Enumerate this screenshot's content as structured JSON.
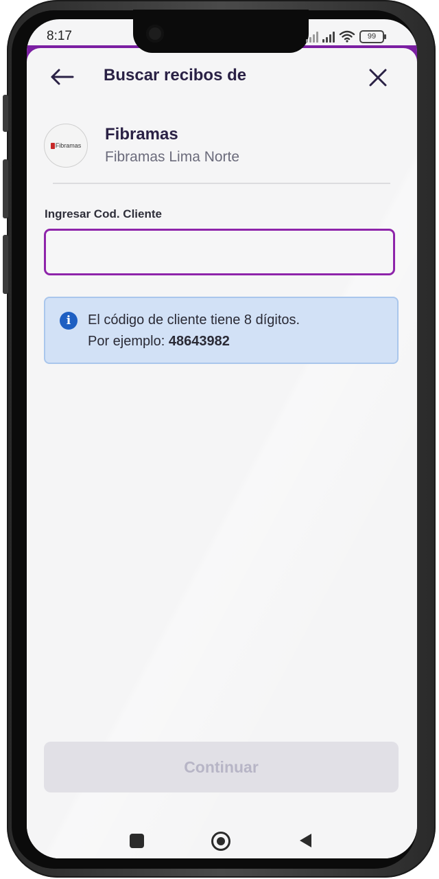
{
  "status_bar": {
    "time": "8:17",
    "battery": "99"
  },
  "header": {
    "title": "Buscar recibos de",
    "back_icon": "arrow-left-icon",
    "close_icon": "close-icon"
  },
  "company": {
    "logo_text": "Fibramas",
    "name": "Fibramas",
    "branch": "Fibramas Lima Norte"
  },
  "form": {
    "label": "Ingresar Cod. Cliente",
    "value": "",
    "accent_color": "#8e24aa"
  },
  "info": {
    "line1": "El código de cliente tiene 8 dígitos.",
    "example_prefix": "Por ejemplo: ",
    "example_code": "48643982"
  },
  "footer": {
    "continue_label": "Continuar",
    "continue_disabled": true
  },
  "colors": {
    "brand_purple": "#7b1fa2",
    "info_bg": "#d2e1f6",
    "info_icon": "#1e5fc2"
  }
}
